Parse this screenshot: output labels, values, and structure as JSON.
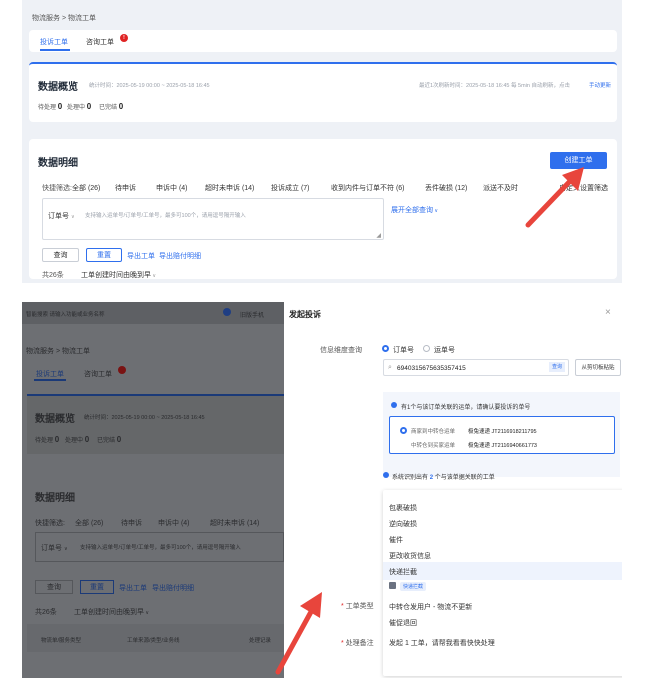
{
  "top": {
    "breadcrumb": "物流服务 > 物流工单",
    "tabs": [
      {
        "label": "投诉工单"
      },
      {
        "label": "咨询工单"
      }
    ],
    "tab_badge": "!",
    "overview": {
      "title": "数据概览",
      "stat_time": "统计时间：2025-05-19 00:00 ~ 2025-05-18 16:45",
      "refresh": "最近1次刷新时间：2025-05-18 16:45  每 5min 自动刷新，点击",
      "manual_refresh": "手动更新",
      "stats": [
        {
          "label": "待处理",
          "value": "0"
        },
        {
          "label": "处理中",
          "value": "0"
        },
        {
          "label": "已完结",
          "value": "0"
        }
      ]
    },
    "detail": {
      "title": "数据明细",
      "create_button": "创建工单",
      "quick_filter_label": "快捷筛选:",
      "filters": [
        "全部 (26)",
        "待申诉",
        "申诉中 (4)",
        "超时未申诉 (14)",
        "投诉成立 (7)",
        "收到内件与订单不符 (6)",
        "丢件破损 (12)",
        "派送不及时"
      ],
      "custom_filter": "自定义设置筛选",
      "order_select": "订单号",
      "order_placeholder": "支持输入运单号/订单号/工单号，最多可100个，请用逗号隔开输入",
      "expand_link": "展开全部查询",
      "query_button": "查询",
      "reset_button": "重置",
      "export_link": "导出工单",
      "export_claim_link": "导出赔付明细",
      "total": "共26条",
      "sort": "工单创建时间由晚到早"
    }
  },
  "bottom_left": {
    "search_placeholder": "智能搜索 请输入功能或业务名称",
    "version": "旧版手机",
    "breadcrumb": "物流服务 > 物流工单",
    "tabs": [
      {
        "label": "投诉工单"
      },
      {
        "label": "咨询工单"
      }
    ],
    "overview_title": "数据概览",
    "stat_time": "统计时间：2025-05-19 00:00 ~ 2025-05-18 16:45",
    "stats": [
      {
        "label": "待处理",
        "value": "0"
      },
      {
        "label": "处理中",
        "value": "0"
      },
      {
        "label": "已完结",
        "value": "0"
      }
    ],
    "detail_title": "数据明细",
    "quick_filter_label": "快捷筛选:",
    "filters": [
      "全部 (26)",
      "待申诉",
      "申诉中 (4)",
      "超时未申诉 (14)"
    ],
    "order_select": "订单号",
    "order_placeholder": "支持输入运单号/订单号/工单号，最多可100个，请用逗号隔开输入",
    "query_button": "查询",
    "reset_button": "重置",
    "export_link": "导出工单",
    "export_claim_link": "导出赔付明细",
    "total": "共26条",
    "sort": "工单创建时间由晚到早",
    "col1": "物流单/服务类型",
    "col2": "工单来源/类型/业务线",
    "col3": "处理记录"
  },
  "dialog": {
    "title": "发起投诉",
    "query_label": "信息维度查询",
    "radio_order": "订单号",
    "radio_waybill": "运单号",
    "order_value": "6940315675635357415",
    "query_button": "查询",
    "paste_button": "从剪切板粘贴",
    "notice": "有1个与该订单关联的运单，请确认要投诉的单号",
    "waybill_line1_label": "商家到中转仓运单",
    "waybill_line1_value": "极兔速递 JT2116918211795",
    "waybill_line2_label": "中转仓到买家运单",
    "waybill_line2_value": "极兔速递 JT2116940661773",
    "system_notice_prefix": "系统识别出有",
    "system_notice_count": "2",
    "system_notice_suffix": "个与该单据关联的工单",
    "menu_items": [
      "包裹破损",
      "逆向破损",
      "催件",
      "更改收货信息",
      "快递拦截"
    ],
    "tag": "快递拦截",
    "menu_items2": [
      "中转仓发用户 - 物流不更新",
      "催促退回"
    ],
    "type_label": "工单类型",
    "remark_label": "处理备注",
    "remark_text": "发起 1 工单，请帮我看看快快处理"
  }
}
